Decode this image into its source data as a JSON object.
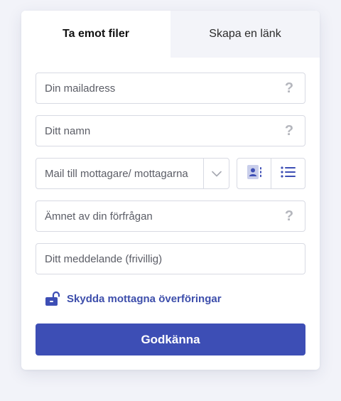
{
  "tabs": [
    {
      "label": "Ta emot filer",
      "active": true
    },
    {
      "label": "Skapa en länk",
      "active": false
    }
  ],
  "form": {
    "email_placeholder": "Din mailadress",
    "name_placeholder": "Ditt namn",
    "recipient_placeholder": "Mail till mottagare/ mottagarna",
    "subject_placeholder": "Ämnet av din förfrågan",
    "message_placeholder": "Ditt meddelande (frivillig)",
    "help_glyph": "?"
  },
  "protect_link_label": "Skydda mottagna överföringar",
  "submit_label": "Godkänna",
  "icons": {
    "help": "question-mark-icon",
    "dropdown": "chevron-down-icon",
    "contacts": "address-book-icon",
    "list": "list-icon",
    "lock": "unlocked-padlock-icon"
  },
  "colors": {
    "accent": "#3d4eb5",
    "link": "#3d4eab",
    "background": "#f2f3f9",
    "inactive_tab": "#f3f4f9"
  }
}
